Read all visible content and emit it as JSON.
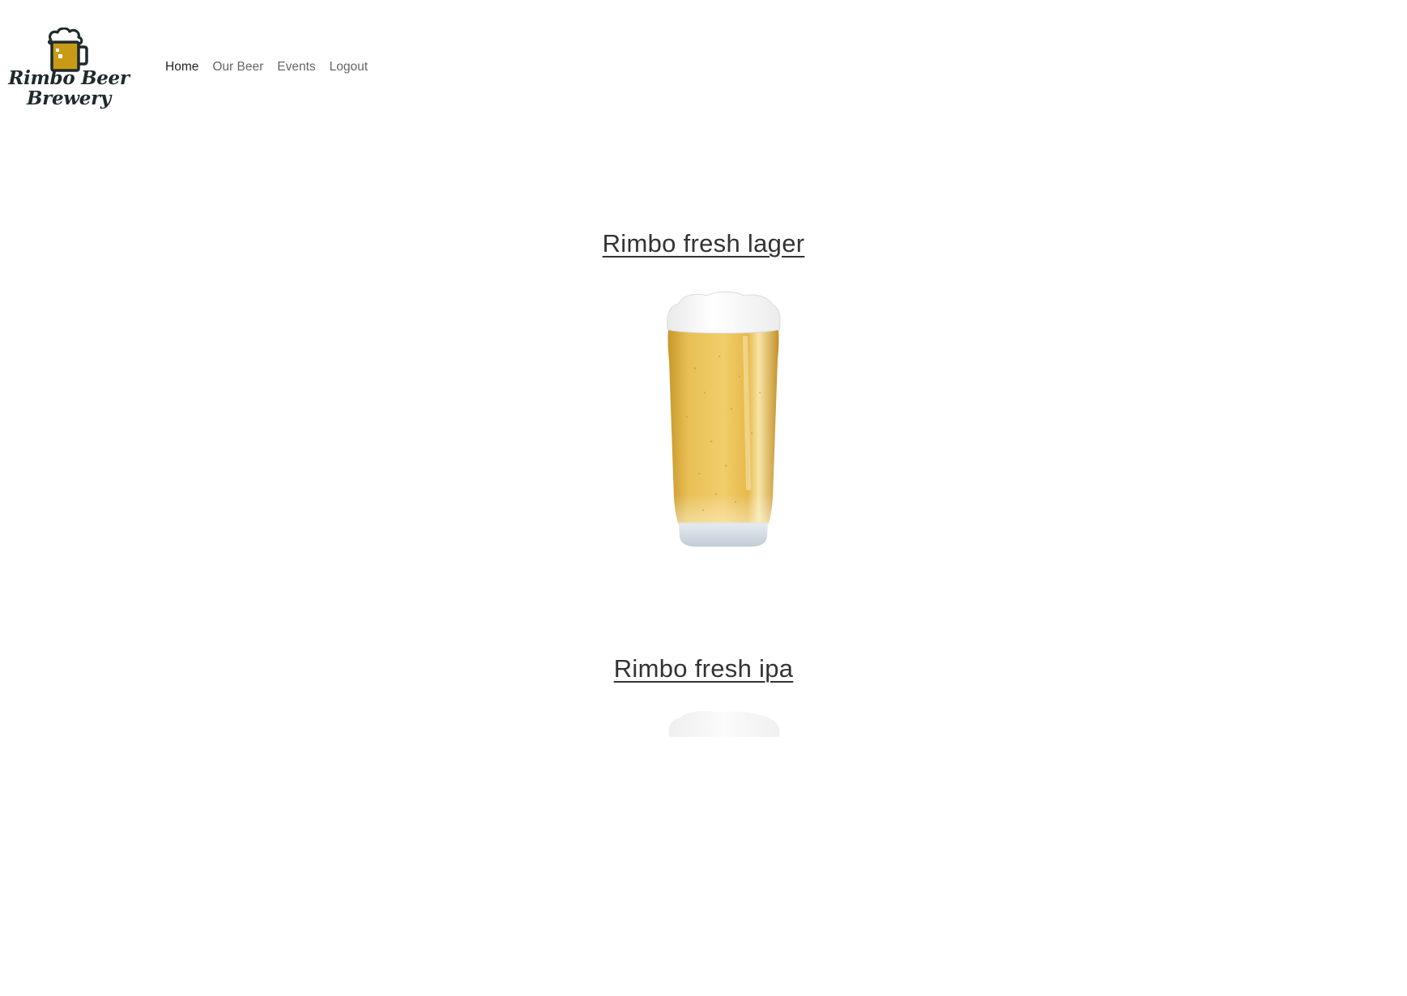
{
  "brand": {
    "name_line1": "Rimbo Beer",
    "name_line2": "Brewery",
    "logo_icon": "beer-mug-icon",
    "logo_color": "#1f2a2d",
    "beer_color": "#c89a17"
  },
  "nav": {
    "items": [
      {
        "label": "Home",
        "active": true
      },
      {
        "label": "Our Beer",
        "active": false
      },
      {
        "label": "Events",
        "active": false
      },
      {
        "label": "Logout",
        "active": false
      }
    ]
  },
  "beers": [
    {
      "name": "Rimbo fresh lager",
      "image": "lager-glass"
    },
    {
      "name": "Rimbo fresh ipa",
      "image": "ipa-glass"
    }
  ]
}
